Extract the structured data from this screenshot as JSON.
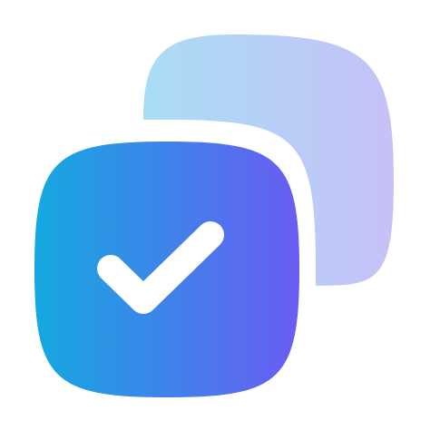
{
  "icon": {
    "name": "copy-checked-icon",
    "front_gradient": [
      "#14A9E0",
      "#6A5CF3"
    ],
    "back_gradient": [
      "#A9DDF5",
      "#C5C1F7"
    ],
    "gap_color": "#ffffff",
    "check_color": "#ffffff"
  }
}
